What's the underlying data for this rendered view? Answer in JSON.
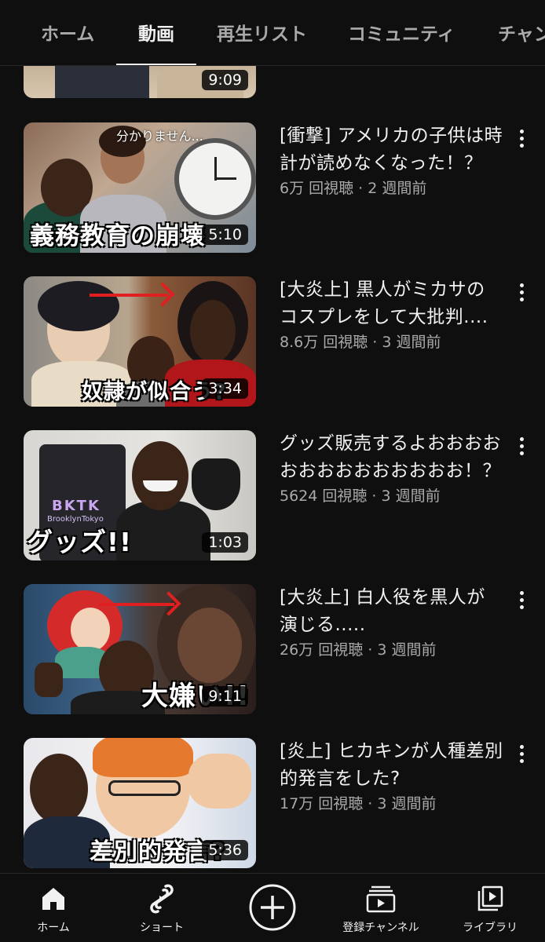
{
  "tabs": [
    {
      "label": "ホーム",
      "active": false
    },
    {
      "label": "動画",
      "active": true
    },
    {
      "label": "再生リスト",
      "active": false
    },
    {
      "label": "コミュニティ",
      "active": false
    },
    {
      "label": "チャンネル",
      "active": false
    }
  ],
  "videos": [
    {
      "title": "",
      "views": "",
      "duration": "9:09",
      "caption": ""
    },
    {
      "title": "[衝撃] アメリカの子供は時計が読めなくなった！？",
      "views": "6万 回視聴 · 2 週間前",
      "duration": "5:10",
      "caption": "義務教育の崩壊",
      "caption_top": "分かりません..."
    },
    {
      "title": "[大炎上] 黒人がミカサのコスプレをして大批判....",
      "views": "8.6万 回視聴 · 3 週間前",
      "duration": "3:34",
      "caption": "奴隷が似合う?"
    },
    {
      "title": "グッズ販売するよおおおおおおおおおおおおおお！？",
      "views": "5624 回視聴 · 3 週間前",
      "duration": "1:03",
      "caption": "グッズ!!",
      "shirt_text": "BKTK",
      "shirt_sub": "BrooklynTokyo"
    },
    {
      "title": "[大炎上] 白人役を黒人が演じる.....",
      "views": "26万 回視聴 · 3 週間前",
      "duration": "9:11",
      "caption": "大嫌い!!"
    },
    {
      "title": "[炎上] ヒカキンが人種差別的発言をした?",
      "views": "17万 回視聴 · 3 週間前",
      "duration": "5:36",
      "caption": "差別的発言?"
    }
  ],
  "bottom_nav": [
    {
      "label": "ホーム",
      "icon": "home-icon"
    },
    {
      "label": "ショート",
      "icon": "shorts-icon"
    },
    {
      "label": "",
      "icon": "create-icon"
    },
    {
      "label": "登録チャンネル",
      "icon": "subscriptions-icon"
    },
    {
      "label": "ライブラリ",
      "icon": "library-icon"
    }
  ],
  "colors": {
    "background": "#0f0f0f",
    "text": "#f1f1f1",
    "secondary": "#aaaaaa",
    "arrow": "#e02020"
  }
}
